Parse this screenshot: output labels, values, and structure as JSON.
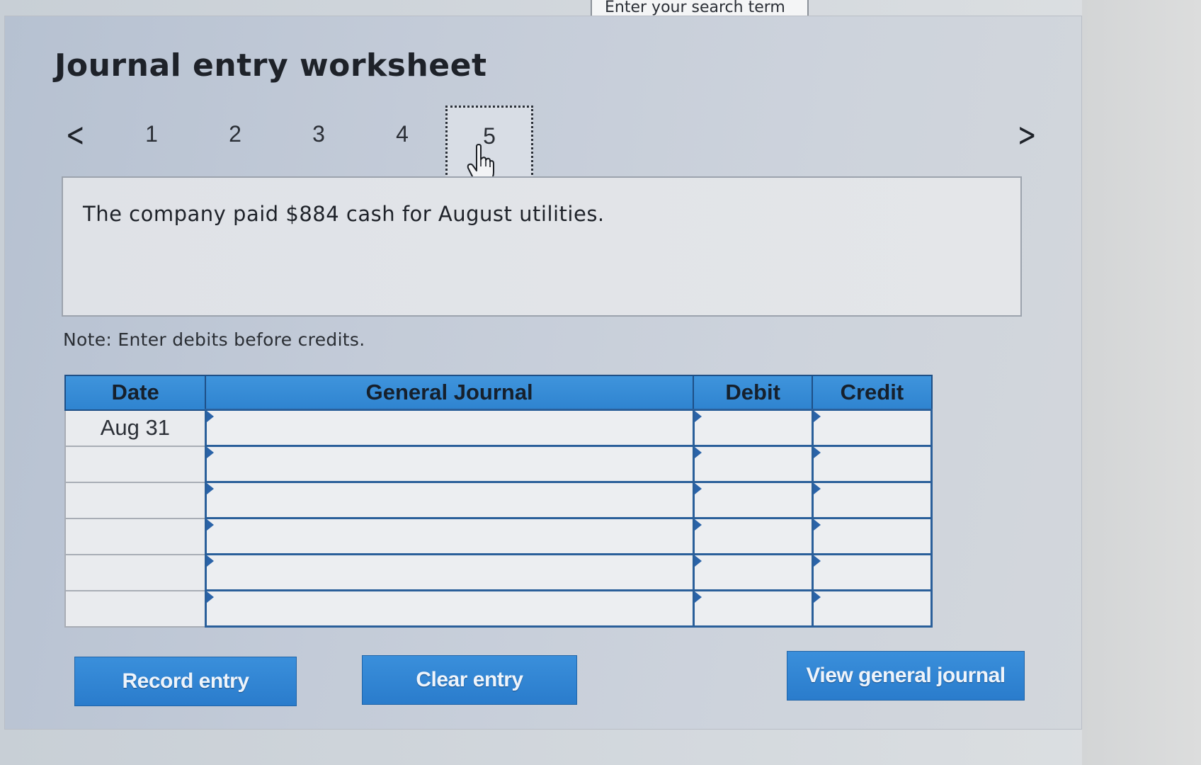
{
  "search": {
    "placeholder": "Enter your search term"
  },
  "worksheet": {
    "title": "Journal entry worksheet",
    "nav": {
      "prev_icon": "chevron-left-icon",
      "next_icon": "chevron-right-icon",
      "prev_glyph": "<",
      "next_glyph": ">",
      "tabs": [
        "1",
        "2",
        "3",
        "4",
        "5"
      ],
      "active_tab": "5"
    },
    "question": "The company paid $884 cash for August utilities.",
    "note": "Note: Enter debits before credits.",
    "table": {
      "headers": {
        "date": "Date",
        "general_journal": "General Journal",
        "debit": "Debit",
        "credit": "Credit"
      },
      "rows": [
        {
          "date": "Aug 31",
          "account": "",
          "debit": "",
          "credit": ""
        },
        {
          "date": "",
          "account": "",
          "debit": "",
          "credit": ""
        },
        {
          "date": "",
          "account": "",
          "debit": "",
          "credit": ""
        },
        {
          "date": "",
          "account": "",
          "debit": "",
          "credit": ""
        },
        {
          "date": "",
          "account": "",
          "debit": "",
          "credit": ""
        },
        {
          "date": "",
          "account": "",
          "debit": "",
          "credit": ""
        }
      ]
    },
    "buttons": {
      "record": "Record entry",
      "clear": "Clear entry",
      "view": "View general journal"
    }
  },
  "colors": {
    "header_blue": "#3a8fdb",
    "button_blue": "#2f84d0",
    "panel_bg": "#c3cbd8"
  }
}
